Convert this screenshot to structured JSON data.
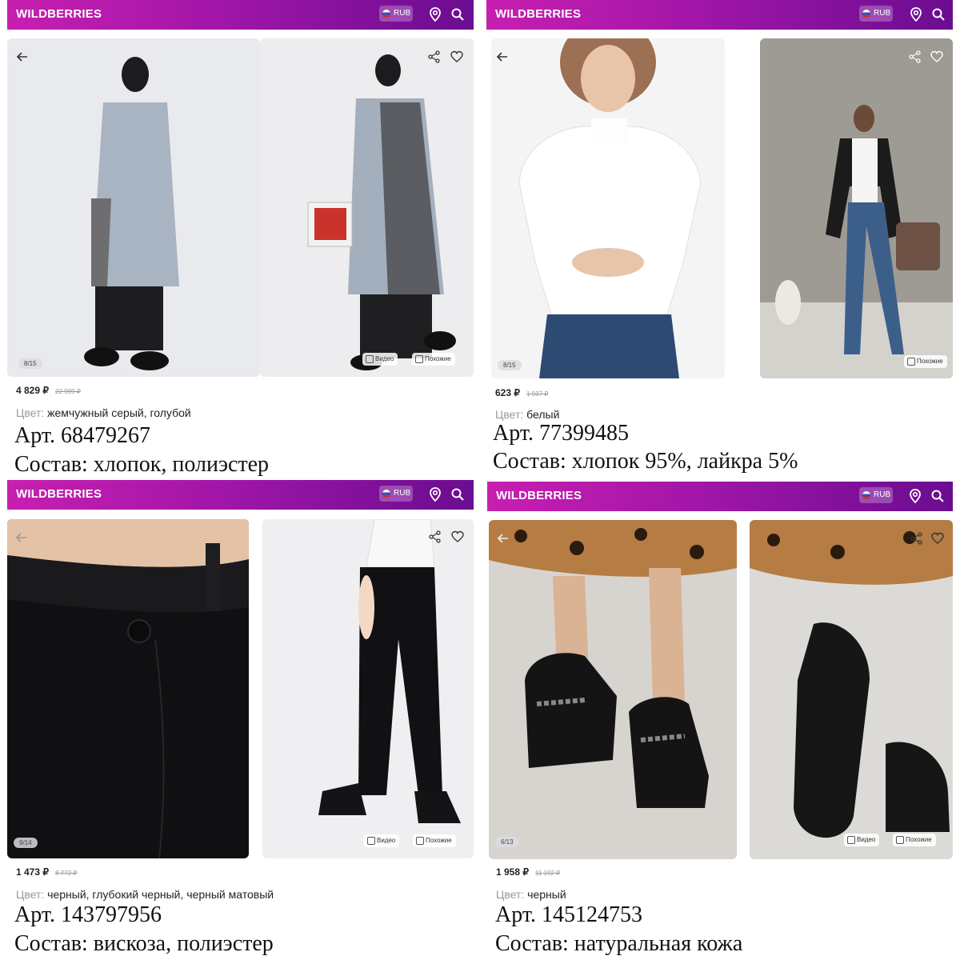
{
  "brand": "WILDBERRIES",
  "currency_label": "RUB",
  "icons": {
    "flag": "russia-flag-icon",
    "location": "location-pin-icon",
    "search": "search-icon",
    "back": "back-arrow-icon",
    "share": "share-icon",
    "favorite": "heart-icon"
  },
  "video_label": "Видео",
  "similar_label": "Похожие",
  "color_label": "Цвет:",
  "products": [
    {
      "pager": "8/15",
      "price": "4 829 ₽",
      "old_price": "22 999 ₽",
      "color": "жемчужный серый, голубой",
      "article": "Арт. 68479267",
      "composition": "Состав: хлопок, полиэстер"
    },
    {
      "pager": "8/15",
      "price": "623 ₽",
      "old_price": "1 937 ₽",
      "color": "белый",
      "article": "Арт. 77399485",
      "composition": "Состав: хлопок 95%, лайкра 5%"
    },
    {
      "pager": "9/14",
      "price": "1 473 ₽",
      "old_price": "8 772 ₽",
      "color": "черный, глубокий черный, черный матовый",
      "article": "Арт. 143797956",
      "composition": "Состав: вискоза, полиэстер"
    },
    {
      "pager": "6/13",
      "price": "1 958 ₽",
      "old_price": "11 192 ₽",
      "color": "черный",
      "article": "Арт. 145124753",
      "composition": "Состав: натуральная кожа"
    }
  ]
}
